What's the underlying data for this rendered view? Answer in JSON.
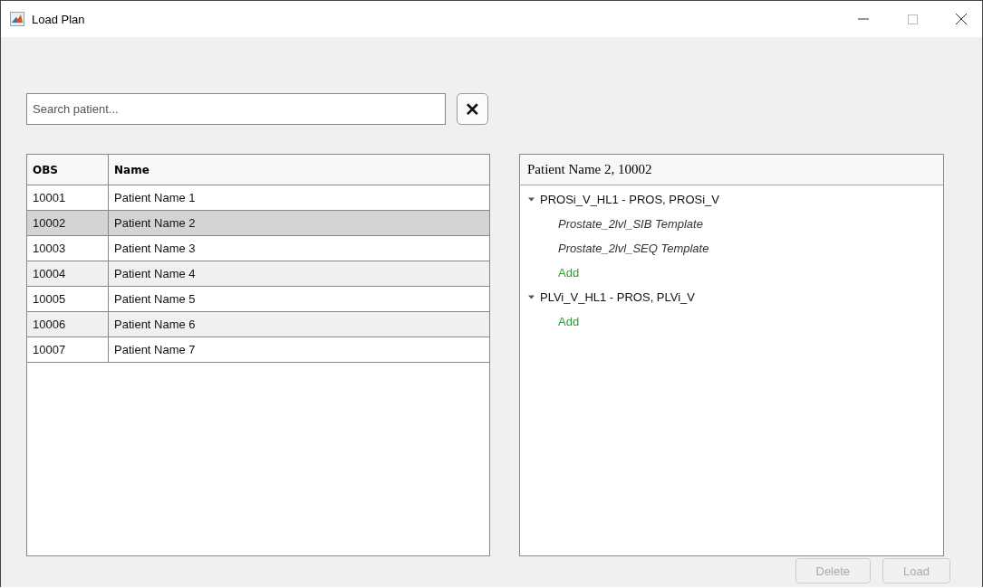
{
  "window": {
    "title": "Load Plan"
  },
  "search": {
    "placeholder": "Search patient...",
    "clear_label": "✕"
  },
  "table": {
    "columns": [
      "OBS",
      "Name"
    ],
    "rows": [
      {
        "cells": [
          "10001",
          "Patient Name 1"
        ],
        "selected": false
      },
      {
        "cells": [
          "10002",
          "Patient Name 2"
        ],
        "selected": true
      },
      {
        "cells": [
          "10003",
          "Patient Name 3"
        ],
        "selected": false
      },
      {
        "cells": [
          "10004",
          "Patient Name 4"
        ],
        "selected": false
      },
      {
        "cells": [
          "10005",
          "Patient Name 5"
        ],
        "selected": false
      },
      {
        "cells": [
          "10006",
          "Patient Name 6"
        ],
        "selected": false
      },
      {
        "cells": [
          "10007",
          "Patient Name 7"
        ],
        "selected": false
      }
    ]
  },
  "plan_panel": {
    "title": "Patient Name 2, 10002",
    "tree": [
      {
        "label": "PROSi_V_HL1 - PROS, PROSi_V",
        "expanded": true,
        "children": [
          {
            "kind": "template",
            "label": "Prostate_2lvl_SIB Template"
          },
          {
            "kind": "template",
            "label": "Prostate_2lvl_SEQ Template"
          },
          {
            "kind": "add",
            "label": "Add"
          }
        ]
      },
      {
        "label": "PLVi_V_HL1 - PROS, PLVi_V",
        "expanded": true,
        "children": [
          {
            "kind": "add",
            "label": "Add"
          }
        ]
      }
    ]
  },
  "buttons": [
    {
      "label": "Delete",
      "disabled": true
    },
    {
      "label": "Load",
      "disabled": true
    }
  ]
}
